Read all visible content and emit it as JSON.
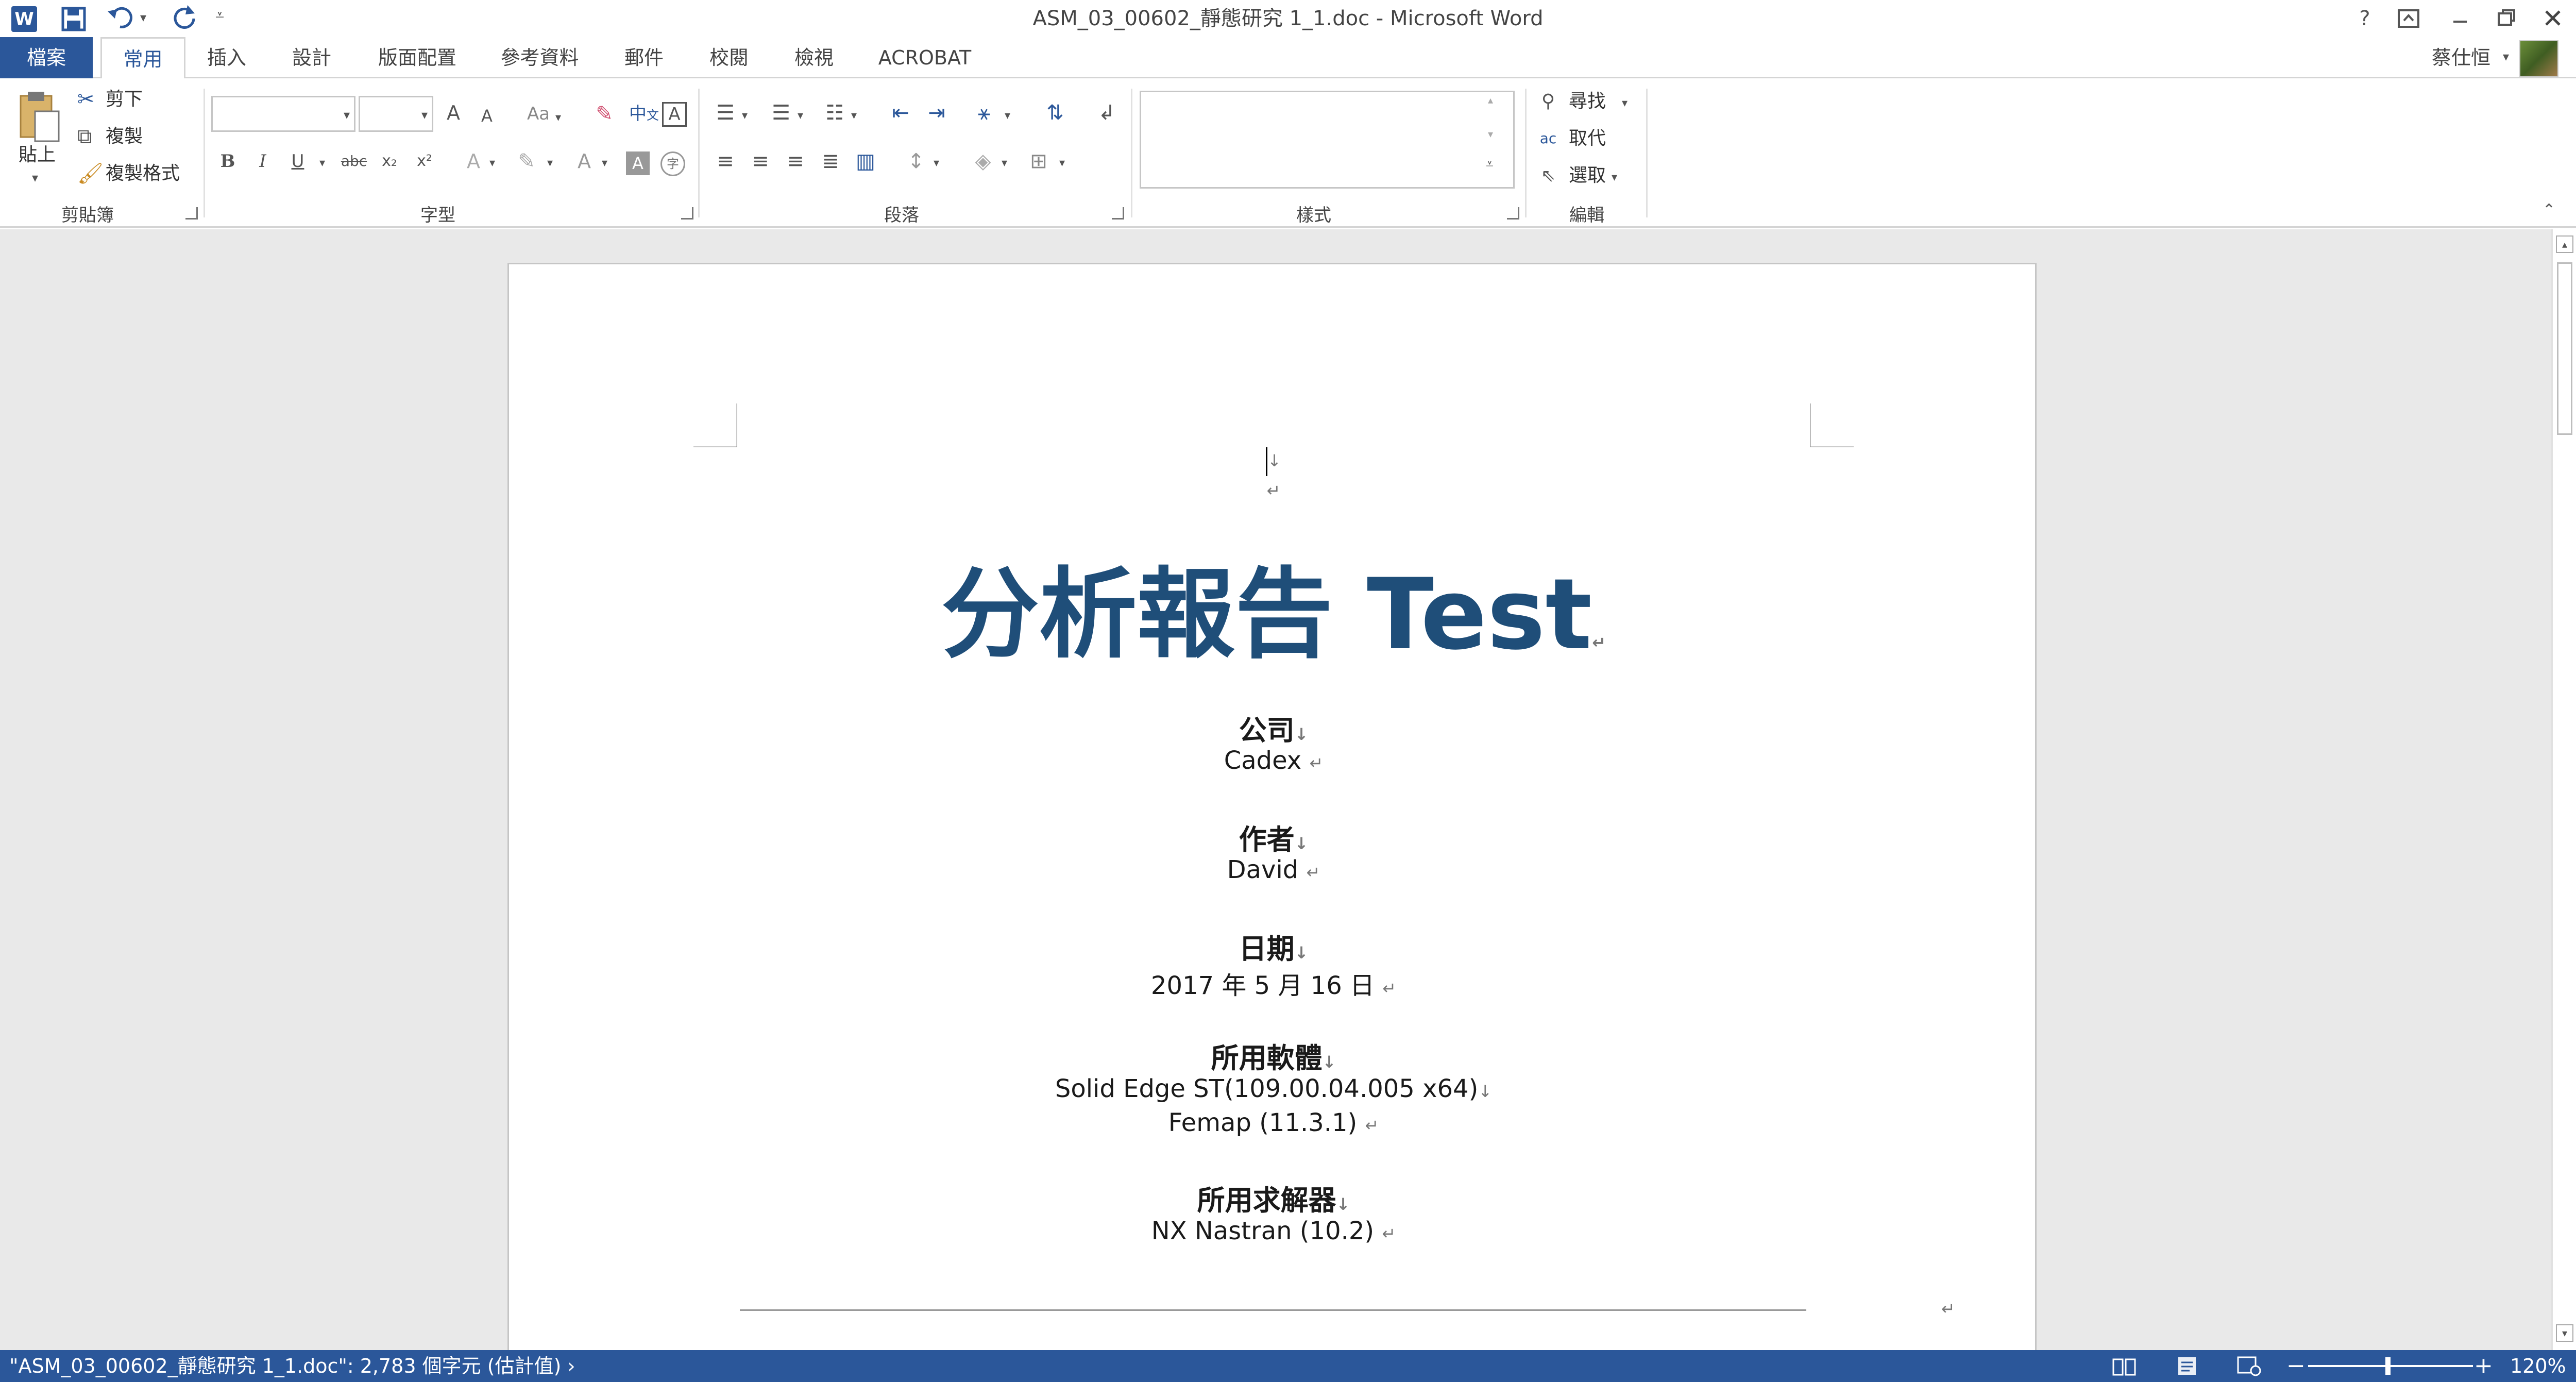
{
  "app": {
    "title": "ASM_03_00602_靜態研究 1_1.doc - Microsoft Word",
    "word_icon": "W",
    "help": "?",
    "user": "蔡仕恒"
  },
  "tabs": [
    {
      "label": "檔案"
    },
    {
      "label": "常用"
    },
    {
      "label": "插入"
    },
    {
      "label": "設計"
    },
    {
      "label": "版面配置"
    },
    {
      "label": "參考資料"
    },
    {
      "label": "郵件"
    },
    {
      "label": "校閱"
    },
    {
      "label": "檢視"
    },
    {
      "label": "ACROBAT"
    }
  ],
  "ribbon": {
    "clipboard": {
      "paste": "貼上",
      "cut": "剪下",
      "copy": "複製",
      "format_painter": "複製格式",
      "label": "剪貼簿"
    },
    "font": {
      "font_name": "",
      "font_size": "",
      "grow": "A",
      "shrink": "A",
      "change_case": "Aa",
      "phonetic": "中",
      "phonetic2": "文",
      "char_border": "A",
      "bold": "B",
      "italic": "I",
      "underline": "U",
      "strike": "abc",
      "subscript": "x₂",
      "superscript": "x²",
      "text_effects": "A",
      "font_color": "A",
      "char_shading": "A",
      "enclose": "字",
      "label": "字型"
    },
    "paragraph": {
      "label": "段落"
    },
    "styles": {
      "label": "樣式"
    },
    "editing": {
      "find": "尋找",
      "replace": "取代",
      "select": "選取",
      "label": "編輯"
    }
  },
  "document": {
    "title": "分析報告 Test",
    "sections": [
      {
        "heading": "公司",
        "lines": [
          "Cadex"
        ]
      },
      {
        "heading": "作者",
        "lines": [
          "David"
        ]
      },
      {
        "heading": "日期",
        "lines": [
          "2017 年 5 月 16 日"
        ]
      },
      {
        "heading": "所用軟體",
        "lines": [
          "Solid Edge ST(109.00.04.005 x64)",
          "Femap (11.3.1)"
        ]
      },
      {
        "heading": "所用求解器",
        "lines": [
          "NX Nastran (10.2)"
        ]
      }
    ],
    "paragraph_mark": "↵",
    "line_break": "↓"
  },
  "status": {
    "text": "\"ASM_03_00602_靜態研究 1_1.doc\": 2,783 個字元 (估計值) ›",
    "zoom": "120%",
    "zoom_minus": "−",
    "zoom_plus": "+"
  },
  "colors": {
    "accent": "#2b579a",
    "title_blue": "#1f4e79"
  }
}
